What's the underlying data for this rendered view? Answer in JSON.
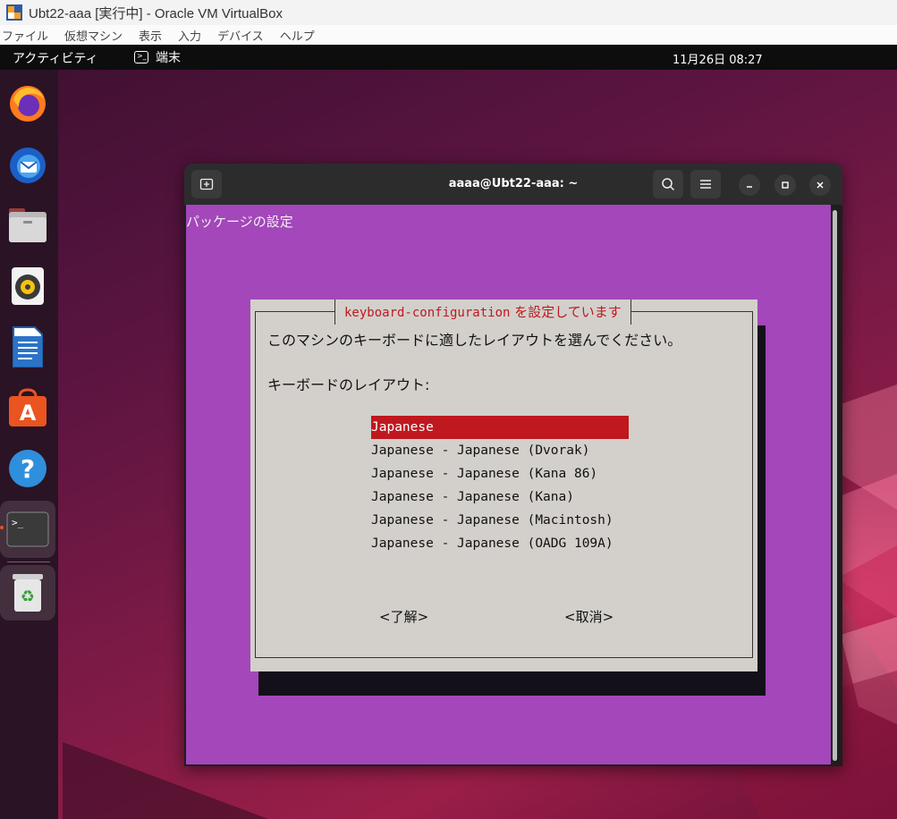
{
  "host": {
    "title": "Ubt22-aaa [実行中] - Oracle VM VirtualBox",
    "menu": [
      "ファイル",
      "仮想マシン",
      "表示",
      "入力",
      "デバイス",
      "ヘルプ"
    ]
  },
  "topbar": {
    "activities": "アクティビティ",
    "app_name": "端末",
    "clock": "11月26日  08:27"
  },
  "dock": {
    "items": [
      "firefox-icon",
      "thunderbird-icon",
      "files-icon",
      "rhythmbox-icon",
      "writer-icon",
      "app-center-icon",
      "help-icon",
      "terminal-icon",
      "trash-icon"
    ],
    "terminal_glyph": ">_"
  },
  "terminal": {
    "title": "aaaa@Ubt22-aaa: ~",
    "backtitle": "パッケージの設定",
    "dialog": {
      "title_pkg": "keyboard-configuration",
      "title_suffix": " を設定しています",
      "message": "このマシンのキーボードに適したレイアウトを選んでください。",
      "label": "キーボードのレイアウト:",
      "options": [
        "Japanese",
        "Japanese - Japanese (Dvorak)",
        "Japanese - Japanese (Kana 86)",
        "Japanese - Japanese (Kana)",
        "Japanese - Japanese (Macintosh)",
        "Japanese - Japanese (OADG 109A)"
      ],
      "selected_index": 0,
      "ok_label": "<了解>",
      "cancel_label": "<取消>"
    }
  },
  "colors": {
    "terminal_bg": "#a347ba",
    "dialog_bg": "#d3d0cb",
    "accent_red": "#c0181f",
    "ubuntu_orange": "#e95420"
  }
}
